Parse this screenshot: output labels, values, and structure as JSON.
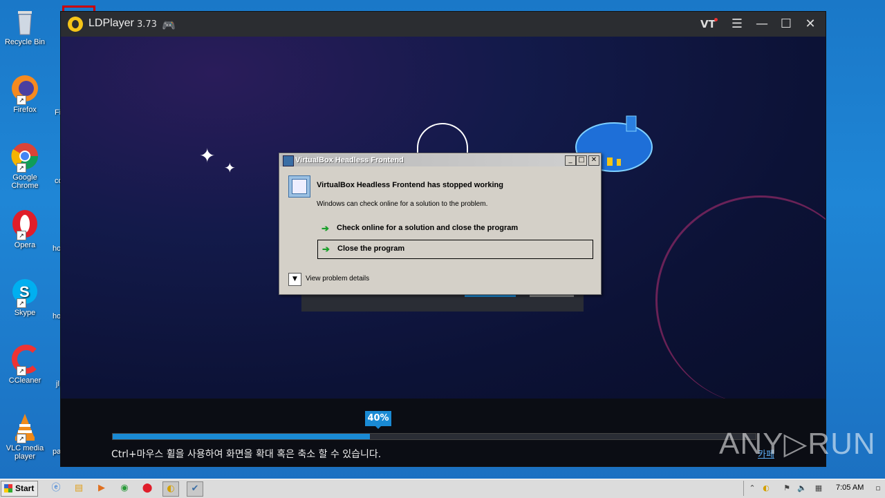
{
  "desktop": {
    "icons": [
      {
        "label": "Recycle Bin",
        "icon": "recycle-bin-icon"
      },
      {
        "label": "Firefox",
        "icon": "firefox-icon"
      },
      {
        "label": "Google Chrome",
        "icon": "chrome-icon"
      },
      {
        "label": "Opera",
        "icon": "opera-icon"
      },
      {
        "label": "Skype",
        "icon": "skype-icon"
      },
      {
        "label": "CCleaner",
        "icon": "ccleaner-icon"
      },
      {
        "label": "VLC media player",
        "icon": "vlc-icon"
      }
    ],
    "cut_labels": [
      "Fi",
      "co",
      "ho",
      "ho",
      "jl",
      "pa"
    ]
  },
  "ldplayer": {
    "app_name": "LDPlayer",
    "version": "3.73",
    "vt_label": "VT",
    "menu_glyph": "☰",
    "minimize_glyph": "—",
    "maximize_glyph": "☐",
    "close_glyph": "✕",
    "progress": {
      "percent_label": "40%",
      "value": 0.4
    },
    "hint_text": "Ctrl+마우스 휠을 사용하여 화면을 확대 혹은 축소 할 수 있습니다.",
    "cafe_link": "카페"
  },
  "dialog": {
    "title": "VirtualBox Headless Frontend",
    "heading": "VirtualBox Headless Frontend has stopped working",
    "subtext": "Windows can check online for a solution to the problem.",
    "option_check_online": "Check online for a solution and close the program",
    "option_close": "Close the program",
    "details_label": "View problem details",
    "arrow_glyph": "➔",
    "chevron_glyph": "▼"
  },
  "watermark": "ANY▷RUN",
  "taskbar": {
    "start_label": "Start",
    "clock": "7:05 AM",
    "colors": {
      "accent": "#1a8ad4"
    }
  }
}
